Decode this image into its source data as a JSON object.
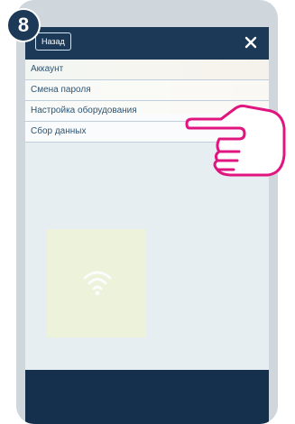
{
  "step": {
    "number": "8"
  },
  "header": {
    "back_label": "Назад",
    "close_icon": "close-icon"
  },
  "menu": {
    "items": [
      {
        "label": "Аккаунт"
      },
      {
        "label": "Смена пароля"
      },
      {
        "label": "Настройка оборудования"
      },
      {
        "label": "Сбор данных"
      }
    ]
  },
  "widget": {
    "icon": "wifi-icon"
  },
  "pointer": {
    "icon": "pointing-hand-icon",
    "color": "#e0157f"
  },
  "colors": {
    "header": "#1c3a57",
    "menu_text": "#2d5574",
    "footer": "#15304c"
  }
}
